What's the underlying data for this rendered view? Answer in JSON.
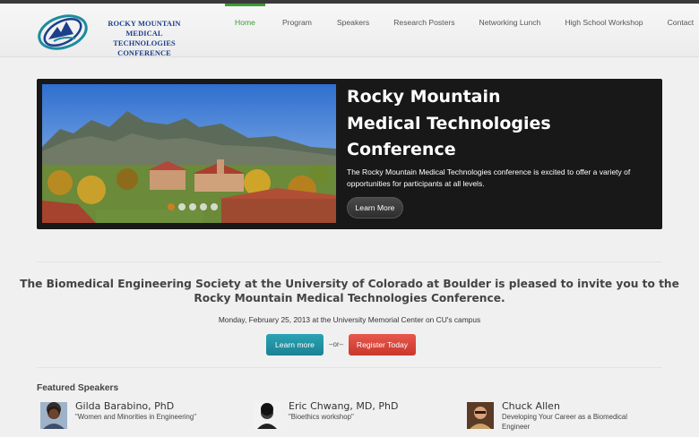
{
  "header": {
    "logo_lines": [
      "ROCKY MOUNTAIN",
      "MEDICAL TECHNOLOGIES",
      "CONFERENCE"
    ]
  },
  "nav": {
    "items": [
      {
        "label": "Home",
        "active": true
      },
      {
        "label": "Program"
      },
      {
        "label": "Speakers"
      },
      {
        "label": "Research Posters"
      },
      {
        "label": "Networking Lunch"
      },
      {
        "label": "High School Workshop"
      },
      {
        "label": "Contact"
      }
    ],
    "active_color": "#3f9c35"
  },
  "hero": {
    "title_lines": [
      "Rocky Mountain",
      "Medical Technologies",
      "Conference"
    ],
    "description": "The Rocky Mountain Medical Technologies conference is excited to offer a variety of opportunities for participants at all levels.",
    "button_label": "Learn More",
    "slide_count": 5,
    "active_slide": 1
  },
  "invite": {
    "text": "The Biomedical Engineering Society at the University of Colorado at Boulder is pleased to invite you to the Rocky Mountain Medical Technologies Conference.",
    "date_line": "Monday, February 25, 2013 at the University Memorial Center on CU's campus",
    "learn_label": "Learn more",
    "or_label": "–or–",
    "register_label": "Register Today"
  },
  "featured": {
    "heading": "Featured Speakers",
    "speakers": [
      {
        "name": "Gilda Barabino, PhD",
        "talk": "\"Women and Minorities in Engineering\""
      },
      {
        "name": "Eric Chwang, MD, PhD",
        "talk": "\"Bioethics workshop\""
      },
      {
        "name": "Chuck Allen",
        "talk": "Developing Your Career as a Biomedical Engineer"
      }
    ]
  },
  "colors": {
    "teal_button": "#1a8293",
    "red_button": "#c9372c",
    "logo_blue": "#1c3f8c"
  }
}
